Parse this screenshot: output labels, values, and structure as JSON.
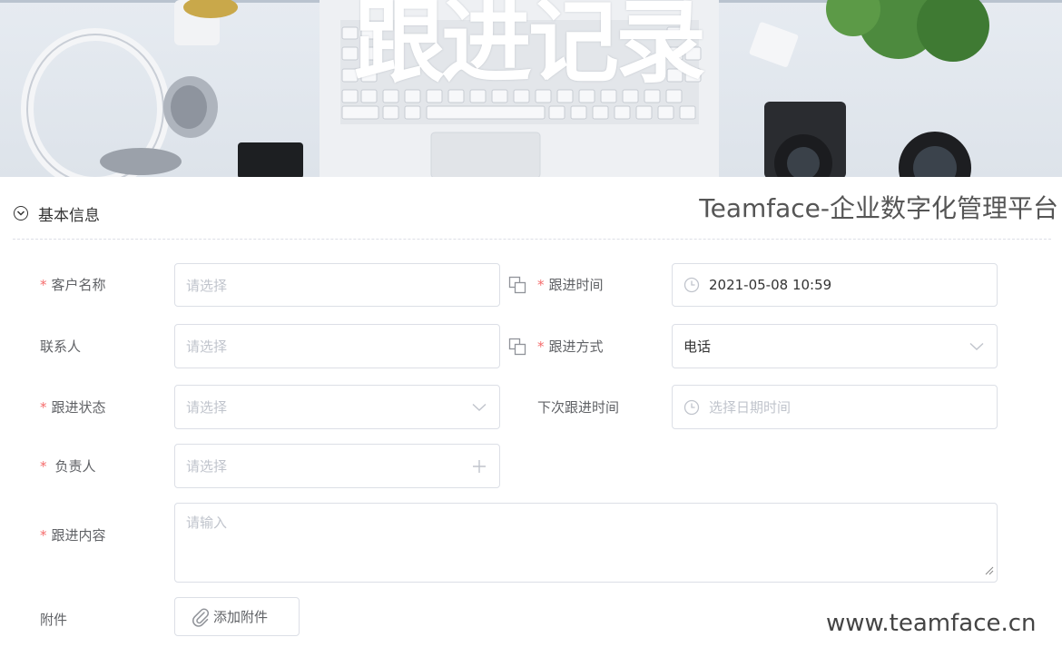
{
  "banner": {
    "title": "跟进记录"
  },
  "section": {
    "title": "基本信息"
  },
  "brand": {
    "text": "Teamface-企业数字化管理平台",
    "site": "www.teamface.cn"
  },
  "form": {
    "required_mark": "*",
    "customer_name": {
      "label": "客户名称",
      "placeholder": "请选择",
      "required": true
    },
    "contact": {
      "label": "联系人",
      "placeholder": "请选择",
      "required": false
    },
    "follow_status": {
      "label": "跟进状态",
      "placeholder": "请选择",
      "required": true
    },
    "owner": {
      "label": "负责人",
      "placeholder": "请选择",
      "required": true
    },
    "follow_time": {
      "label": "跟进时间",
      "value": "2021-05-08 10:59",
      "required": true
    },
    "follow_method": {
      "label": "跟进方式",
      "value": "电话",
      "required": true
    },
    "next_follow_time": {
      "label": "下次跟进时间",
      "placeholder": "选择日期时间",
      "required": false
    },
    "follow_content": {
      "label": "跟进内容",
      "placeholder": "请输入",
      "required": true
    },
    "attachment": {
      "label": "附件",
      "button_label": "添加附件"
    }
  },
  "icons": {
    "section_toggle": "chevron-down-circle-icon",
    "copy": "copy-icon",
    "clock": "clock-icon",
    "dropdown": "chevron-down-icon",
    "add": "plus-icon",
    "attach": "paperclip-icon"
  },
  "colors": {
    "required": "#f56c6c",
    "border": "#dcdfe6",
    "placeholder": "#c0c4cc"
  }
}
